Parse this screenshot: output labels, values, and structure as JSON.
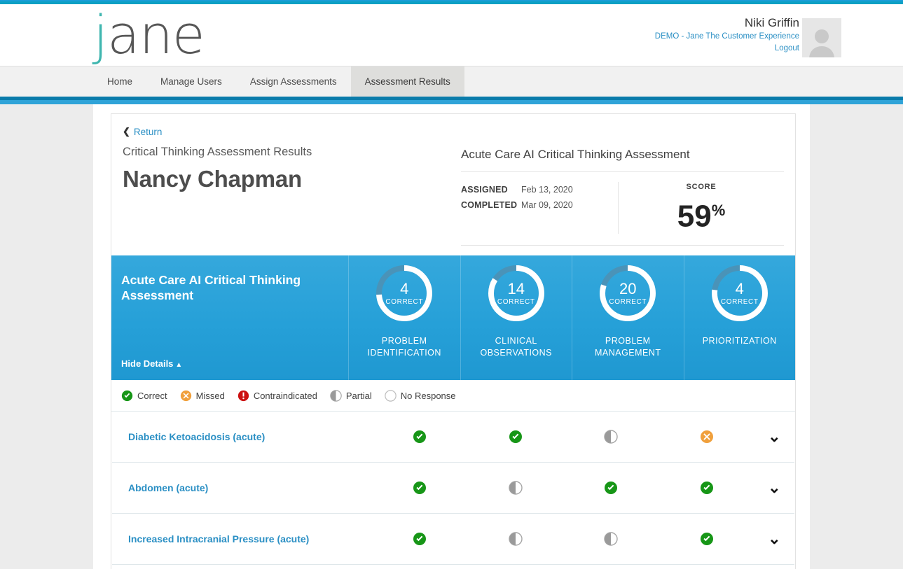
{
  "brand": {
    "logo_j": "j",
    "logo_rest": "ane"
  },
  "header": {
    "user_name": "Niki Griffin",
    "organization": "DEMO - Jane The Customer Experience",
    "logout": "Logout",
    "avatar_icon": "user-avatar-icon"
  },
  "nav": {
    "items": [
      {
        "label": "Home",
        "active": false
      },
      {
        "label": "Manage Users",
        "active": false
      },
      {
        "label": "Assign Assessments",
        "active": false
      },
      {
        "label": "Assessment Results",
        "active": true
      }
    ]
  },
  "page": {
    "return_label": "Return",
    "return_icon": "chevron-left-icon",
    "subtitle": "Critical Thinking Assessment Results",
    "person_name": "Nancy Chapman"
  },
  "summary": {
    "assessment_name": "Acute Care AI Critical Thinking Assessment",
    "assigned_label": "ASSIGNED",
    "assigned_value": "Feb 13, 2020",
    "completed_label": "COMPLETED",
    "completed_value": "Mar 09, 2020",
    "score_label": "SCORE",
    "score_value": "59",
    "score_unit": "%"
  },
  "panel": {
    "title": "Acute Care AI Critical Thinking Assessment",
    "hide_details_label": "Hide Details",
    "hide_details_icon": "caret-up-icon",
    "background_color": "#29a0d8"
  },
  "chart_data": {
    "type": "pie",
    "title": "Acute Care AI Critical Thinking Assessment",
    "legend_position": "none",
    "donuts": [
      {
        "value": 4,
        "unit": "CORRECT",
        "category": "PROBLEM IDENTIFICATION",
        "percent": 74
      },
      {
        "value": 14,
        "unit": "CORRECT",
        "category": "CLINICAL OBSERVATIONS",
        "percent": 84
      },
      {
        "value": 20,
        "unit": "CORRECT",
        "category": "PROBLEM MANAGEMENT",
        "percent": 80
      },
      {
        "value": 4,
        "unit": "CORRECT",
        "category": "PRIORITIZATION",
        "percent": 77
      }
    ],
    "track_color": "#4a93b8",
    "arc_color": "#ffffff"
  },
  "legend": {
    "items": [
      {
        "label": "Correct",
        "status": "correct",
        "color": "#1e9d1e"
      },
      {
        "label": "Missed",
        "status": "missed",
        "color": "#f0a martyr"
      },
      {
        "label": "Contraindicated",
        "status": "contraindicated",
        "color": "#cc1111"
      },
      {
        "label": "Partial",
        "status": "partial",
        "color": "#9a9a9a"
      },
      {
        "label": "No Response",
        "status": "none",
        "color": "#bdbdbd"
      }
    ]
  },
  "results": {
    "expand_icon": "chevron-down-icon",
    "rows": [
      {
        "title": "Diabetic Ketoacidosis (acute)",
        "marks": [
          "correct",
          "correct",
          "partial",
          "missed"
        ]
      },
      {
        "title": "Abdomen (acute)",
        "marks": [
          "correct",
          "partial",
          "correct",
          "correct"
        ]
      },
      {
        "title": "Increased Intracranial Pressure (acute)",
        "marks": [
          "correct",
          "partial",
          "partial",
          "correct"
        ]
      }
    ]
  }
}
